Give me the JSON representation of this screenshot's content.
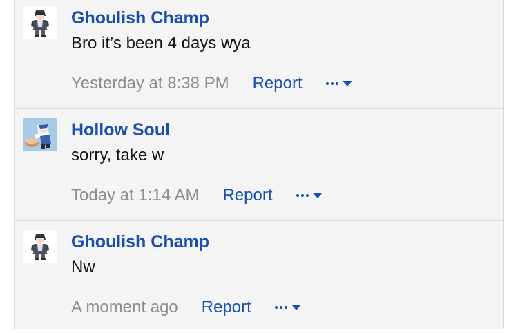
{
  "comments": [
    {
      "author": "Ghoulish Champ",
      "text": "Bro it’s been 4 days wya",
      "timestamp": "Yesterday at 8:38 PM",
      "report_label": "Report",
      "avatar": "ghoulish-champ-avatar"
    },
    {
      "author": "Hollow Soul",
      "text": "sorry, take w",
      "timestamp": "Today at 1:14 AM",
      "report_label": "Report",
      "avatar": "hollow-soul-avatar"
    },
    {
      "author": "Ghoulish Champ",
      "text": "Nw",
      "timestamp": "A moment ago",
      "report_label": "Report",
      "avatar": "ghoulish-champ-avatar"
    }
  ],
  "colors": {
    "link": "#1a4fae",
    "timestamp": "#8d8d8d",
    "background": "#f4f4f4"
  },
  "icons": {
    "more": "ellipsis-icon",
    "dropdown": "caret-down-icon"
  }
}
